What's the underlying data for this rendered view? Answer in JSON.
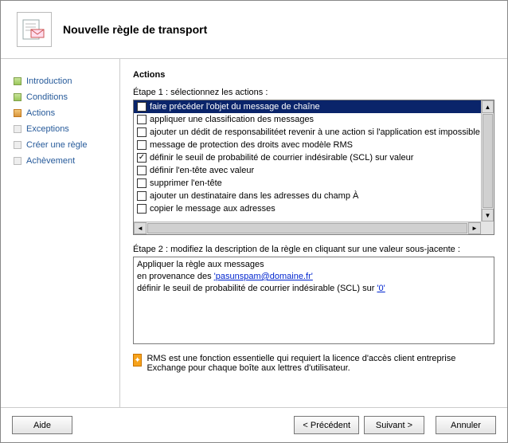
{
  "header": {
    "title": "Nouvelle règle de transport"
  },
  "sidebar": {
    "items": [
      {
        "label": "Introduction",
        "state": "done"
      },
      {
        "label": "Conditions",
        "state": "done"
      },
      {
        "label": "Actions",
        "state": "active"
      },
      {
        "label": "Exceptions",
        "state": "dim"
      },
      {
        "label": "Créer une règle",
        "state": "dim"
      },
      {
        "label": "Achèvement",
        "state": "dim"
      }
    ]
  },
  "content": {
    "section_title": "Actions",
    "step1_label": "Étape 1 : sélectionnez les actions :",
    "actions": [
      {
        "label": "faire précéder l'objet du message de chaîne",
        "checked": false,
        "selected": true
      },
      {
        "label": "appliquer une classification des messages",
        "checked": false
      },
      {
        "label": "ajouter un dédit de responsabilitéet revenir à une action si l'application est impossible",
        "checked": false
      },
      {
        "label": "message de protection des droits avec modèle RMS",
        "checked": false
      },
      {
        "label": "définir le seuil de probabilité de courrier indésirable (SCL) sur valeur",
        "checked": true
      },
      {
        "label": "définir l'en-tête avec valeur",
        "checked": false
      },
      {
        "label": "supprimer l'en-tête",
        "checked": false
      },
      {
        "label": "ajouter un destinataire dans les adresses du champ À",
        "checked": false
      },
      {
        "label": "copier le message aux adresses",
        "checked": false
      }
    ],
    "step2_label": "Étape 2 : modifiez la description de la règle en cliquant sur une valeur sous-jacente :",
    "description": {
      "line1": "Appliquer la règle aux messages",
      "line2_prefix": "en provenance des ",
      "line2_link": "'pasunspam@domaine.fr'",
      "line3_prefix": "définir le seuil de probabilité de courrier indésirable (SCL) sur ",
      "line3_link": "'0'"
    },
    "rms_note": "RMS est une fonction essentielle qui requiert la licence d'accès client entreprise Exchange pour chaque boîte aux lettres d'utilisateur."
  },
  "buttons": {
    "help": "Aide",
    "back": "< Précédent",
    "next": "Suivant >",
    "cancel": "Annuler"
  }
}
